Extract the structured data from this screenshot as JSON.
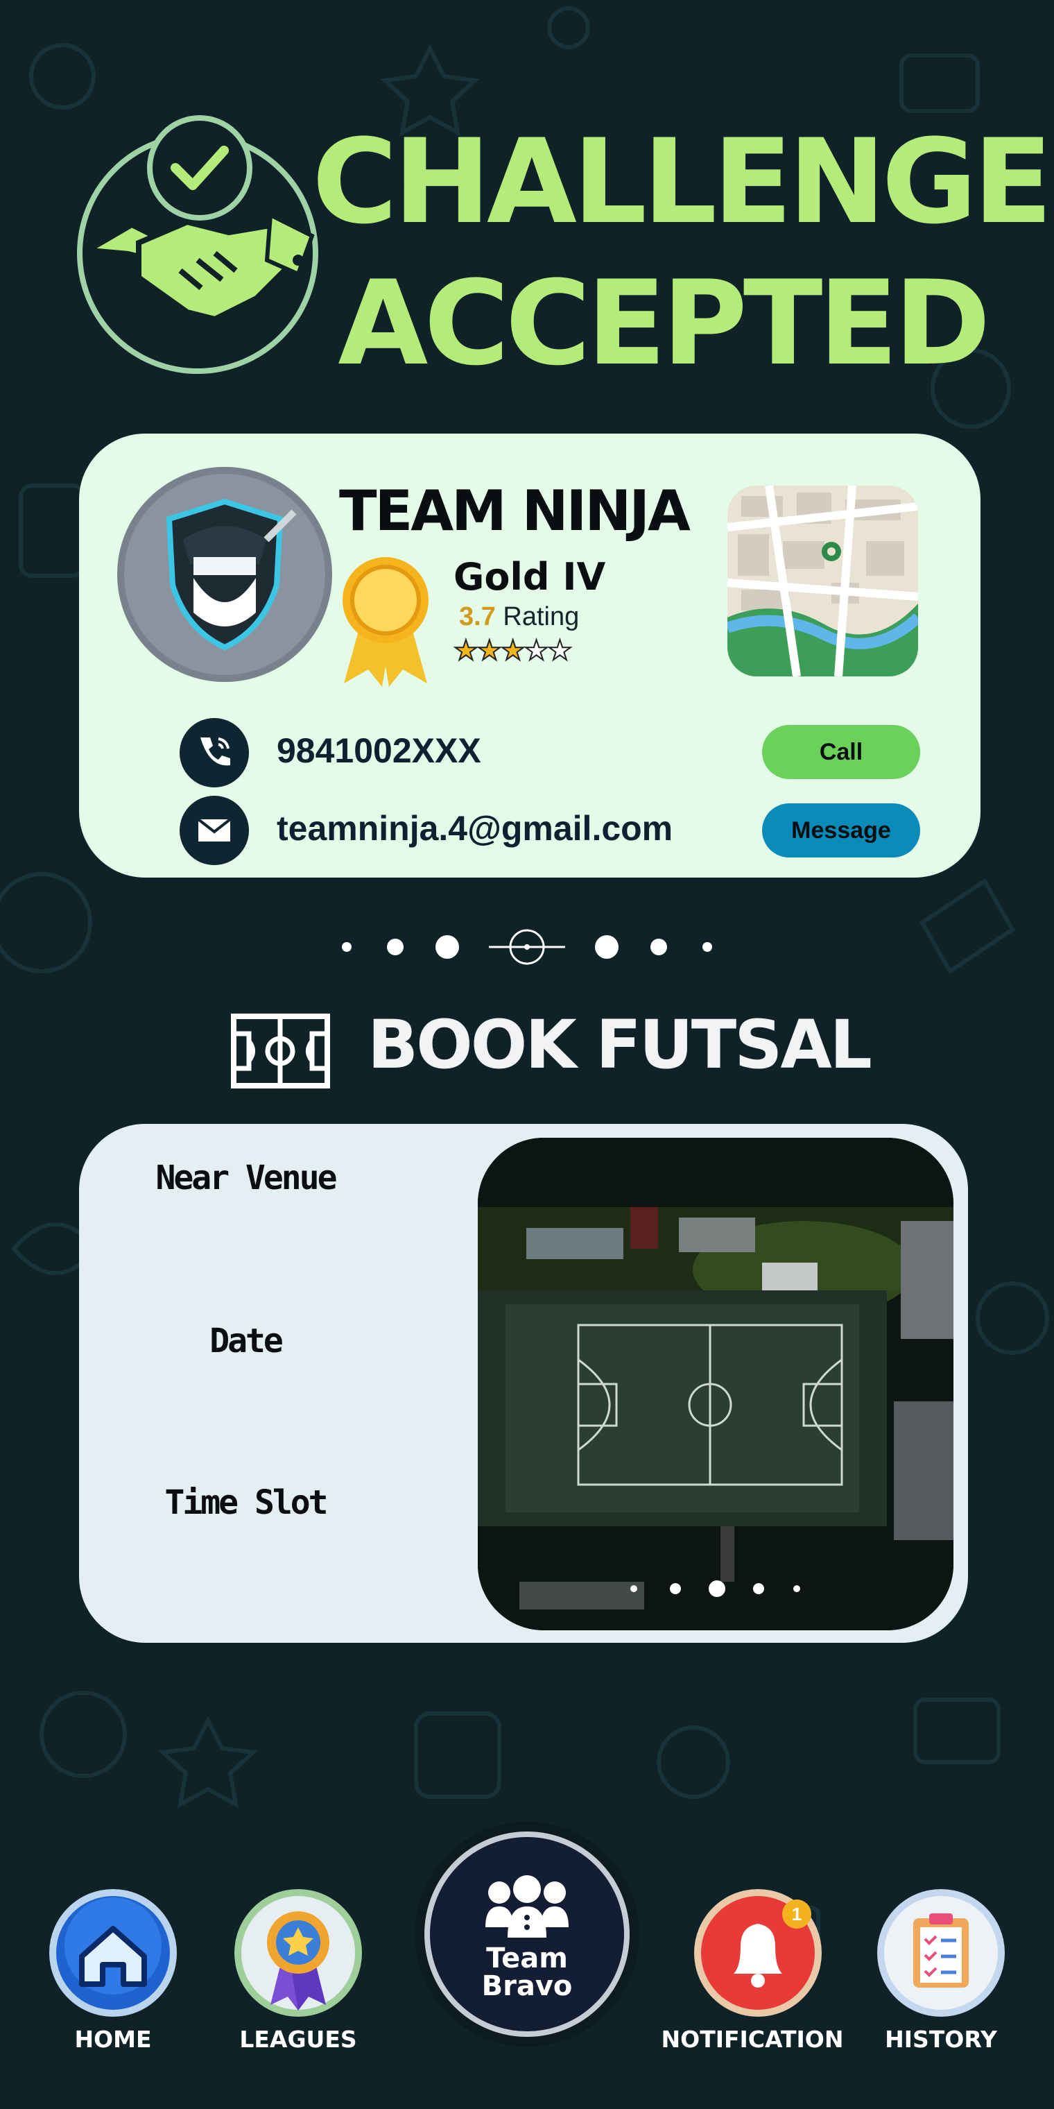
{
  "header": {
    "title_line1": "CHALLENGE",
    "title_line2": "ACCEPTED",
    "icon": "handshake-check-icon"
  },
  "team": {
    "name": "TEAM NINJA",
    "tier": "Gold IV",
    "rating_value": "3.7",
    "rating_label": "Rating",
    "stars": 2.5,
    "stars_max": 5,
    "phone": "9841002XXX",
    "email": "teamninja.4@gmail.com",
    "call_label": "Call",
    "message_label": "Message"
  },
  "booking": {
    "title": "BOOK FUTSAL",
    "near_venue_label": "Near Venue",
    "date_label": "Date",
    "time_slot_label": "Time Slot",
    "photo_icon": "futsal-court-aerial-photo"
  },
  "nav": {
    "home": "HOME",
    "leagues": "LEAGUES",
    "center_line1": "Team",
    "center_line2": "Bravo",
    "notification": "NOTIFICATION",
    "notification_count": "1",
    "history": "HISTORY"
  },
  "colors": {
    "background": "#0e2228",
    "accent_green": "#b4ec7a",
    "card_bg": "#e4fbe8",
    "call_green": "#6bd15a",
    "message_blue": "#0b8bb8"
  }
}
